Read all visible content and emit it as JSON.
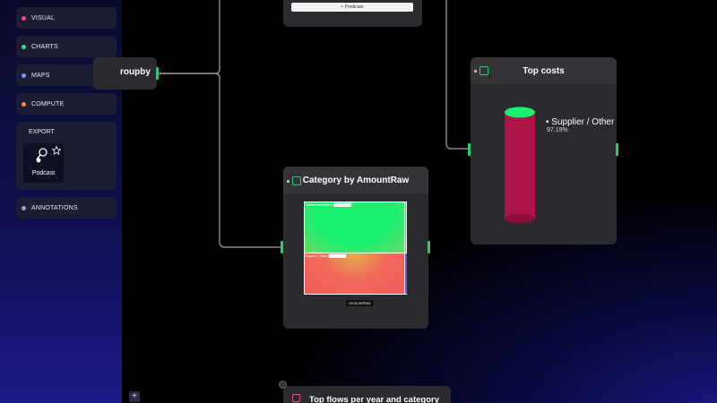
{
  "sidebar": {
    "items": [
      {
        "label": "VISUAL",
        "color": "#e84a7f"
      },
      {
        "label": "CHARTS",
        "color": "#3ddc84"
      },
      {
        "label": "MAPS",
        "color": "#8d8dff"
      },
      {
        "label": "COMPUTE",
        "color": "#ff8a3d"
      }
    ],
    "export": {
      "title": "EXPORT",
      "card_label": "Podcast"
    },
    "annotations": {
      "label": "ANNOTATIONS",
      "color": "#a0a0c0"
    },
    "add_label": "+"
  },
  "nodes": {
    "groupby": {
      "title": "roupby"
    },
    "filter": {
      "predicate_label": "+ Predicate"
    },
    "top_costs": {
      "title": "Top costs",
      "legend_label": "• Supplier / Other",
      "percent": "97.19%",
      "fill_fraction": 0.9719
    },
    "category": {
      "title": "Category by AmountRaw",
      "tile_top_label": "Taxes/Fees/Carbon  ████████",
      "tile_bottom_label": "Supplier / Other  ████████",
      "axis_label": "AmountRaw"
    },
    "flows": {
      "title": "Top flows per year and category"
    }
  },
  "colors": {
    "accent": "#22d16e",
    "cylinder": "#b0124a",
    "tile_top": "#19f06f",
    "tile_bottom": "#f05a5a"
  }
}
